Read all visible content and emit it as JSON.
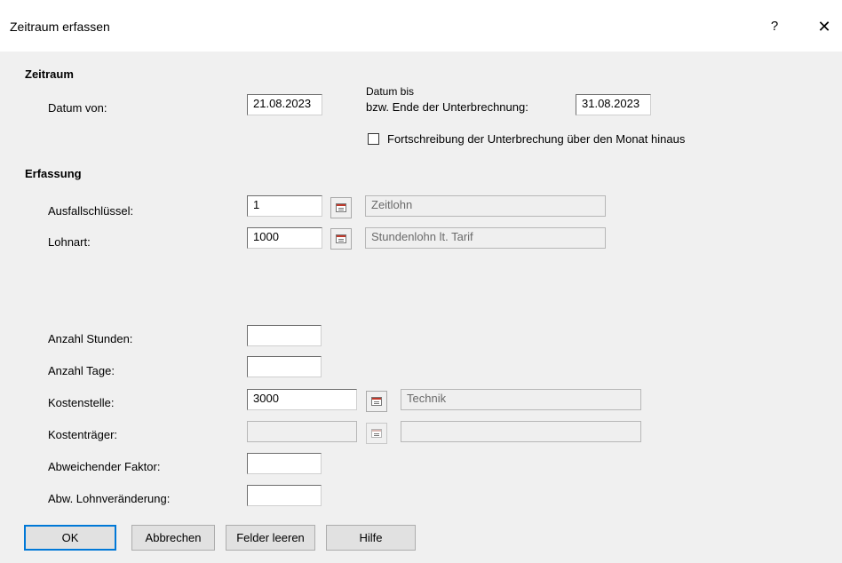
{
  "window": {
    "title": "Zeitraum erfassen",
    "help_label": "?",
    "close_label": "✕"
  },
  "zeitraum": {
    "title": "Zeitraum",
    "datum_von_label": "Datum von:",
    "datum_von_value": "21.08.2023",
    "datum_bis_label_1": "Datum bis",
    "datum_bis_label_2": "bzw. Ende der Unterbrechnung:",
    "datum_bis_value": "31.08.2023",
    "fortschreibung_label": "Fortschreibung der Unterbrechung über den Monat hinaus",
    "fortschreibung_checked": false
  },
  "erfassung": {
    "title": "Erfassung",
    "ausfall_label": "Ausfallschlüssel:",
    "ausfall_value": "1",
    "ausfall_desc": "Zeitlohn",
    "lohnart_label": "Lohnart:",
    "lohnart_value": "1000",
    "lohnart_desc": "Stundenlohn lt. Tarif",
    "stunden_label": "Anzahl Stunden:",
    "stunden_value": "",
    "tage_label": "Anzahl Tage:",
    "tage_value": "",
    "kostenstelle_label": "Kostenstelle:",
    "kostenstelle_value": "3000",
    "kostenstelle_desc": "Technik",
    "kostentraeger_label": "Kostenträger:",
    "kostentraeger_value": "",
    "kostentraeger_desc": "",
    "faktor_label": "Abweichender Faktor:",
    "faktor_value": "",
    "lohnveraenderung_label": "Abw. Lohnveränderung:",
    "lohnveraenderung_value": ""
  },
  "buttons": {
    "ok": "OK",
    "abbrechen": "Abbrechen",
    "felder_leeren": "Felder leeren",
    "hilfe": "Hilfe"
  },
  "icons": {
    "lookup": "list-lookup-icon",
    "help": "question-icon",
    "close": "close-icon"
  }
}
